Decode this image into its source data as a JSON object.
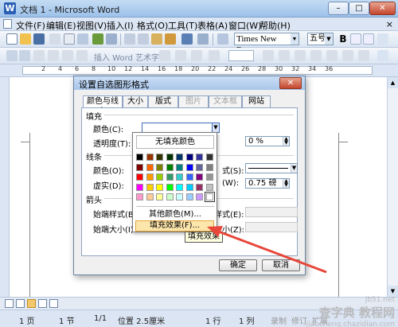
{
  "window": {
    "title": "文档 1 - Microsoft Word",
    "min": "–",
    "max": "□",
    "close": "✕"
  },
  "menubar": {
    "items": [
      "文件(F)",
      "编辑(E)",
      "视图(V)",
      "插入(I)",
      "格式(O)",
      "工具(T)",
      "表格(A)",
      "窗口(W)",
      "帮助(H)"
    ],
    "close": "×"
  },
  "toolbar": {
    "font_name": "Times New Roma",
    "font_size": "五号",
    "insert_wordart": "插入 Word 艺术字"
  },
  "ruler": {
    "numbers": [
      "2",
      "4",
      "6",
      "8",
      "10",
      "12",
      "14",
      "16",
      "18",
      "20",
      "22",
      "24",
      "26",
      "28",
      "30",
      "32",
      "34",
      "36"
    ]
  },
  "dialog": {
    "title": "设置自选图形格式",
    "close": "✕",
    "tabs": [
      "颜色与线条",
      "大小",
      "版式",
      "图片",
      "文本框",
      "网站"
    ],
    "fill_section": "填充",
    "fill_color_label": "颜色(C):",
    "transparency_label": "透明度(T):",
    "transparency_value": "0 %",
    "line_section": "线条",
    "line_color_label": "颜色(O):",
    "line_dash_label": "虚实(D):",
    "line_style_label_tail": "式(S):",
    "line_weight_label_tail": "(W):",
    "line_weight_value": "0.75 磅",
    "arrows_section": "箭头",
    "begin_style_label": "始端样式(B):",
    "begin_size_label": "始端大小(I):",
    "end_style_label_tail": "样式(E):",
    "end_size_label_tail": "小(Z):",
    "ok": "确定",
    "cancel": "取消"
  },
  "palette": {
    "no_fill": "无填充颜色",
    "more_colors": "其他颜色(M)...",
    "fill_effects": "填充效果(F)...",
    "tooltip": "填充效果",
    "colors": [
      "#000000",
      "#993300",
      "#333300",
      "#003300",
      "#003366",
      "#000080",
      "#333399",
      "#333333",
      "#800000",
      "#ff6600",
      "#808000",
      "#008000",
      "#008080",
      "#0000ff",
      "#666699",
      "#808080",
      "#ff0000",
      "#ff9900",
      "#99cc00",
      "#339966",
      "#33cccc",
      "#3366ff",
      "#800080",
      "#969696",
      "#ff00ff",
      "#ffcc00",
      "#ffff00",
      "#00ff00",
      "#00ffff",
      "#00ccff",
      "#993366",
      "#c0c0c0",
      "#ff99cc",
      "#ffcc99",
      "#ffff99",
      "#ccffcc",
      "#ccffff",
      "#99ccff",
      "#cc99ff",
      "#ffffff"
    ]
  },
  "statusbar": {
    "page": "1 页",
    "section": "1 节",
    "page_of": "1/1",
    "position": "位置 2.5厘米",
    "line": "1 行",
    "column": "1 列",
    "rec": "录制",
    "trk": "修订",
    "ext": "扩展"
  },
  "watermark": {
    "line1": "查字典 教程网",
    "line2": "jiaocheng.chazidian.com",
    "line3": "jb51.net"
  },
  "colors": {
    "accent": "#3d6fbd",
    "highlight": "#fde6ab",
    "arrow": "#e8463a"
  }
}
